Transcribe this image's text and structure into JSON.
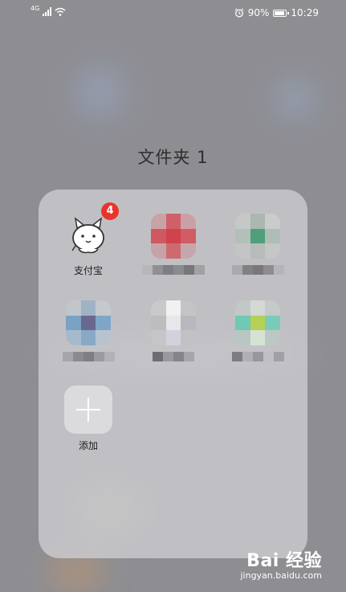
{
  "status_bar": {
    "network_type": "4G",
    "battery_percent": "90%",
    "time": "10:29",
    "icons": [
      "signal-icon",
      "wifi-icon",
      "alarm-icon",
      "battery-icon"
    ]
  },
  "folder": {
    "title": "文件夹 1",
    "apps": [
      {
        "label": "支付宝",
        "badge": "4",
        "icon": "alipay-icon"
      },
      {
        "label": "",
        "icon": "pixelated-red-icon"
      },
      {
        "label": "",
        "icon": "pixelated-green-icon"
      },
      {
        "label": "",
        "icon": "pixelated-blue-icon"
      },
      {
        "label": "",
        "icon": "pixelated-white-icon"
      },
      {
        "label": "",
        "icon": "pixelated-teal-icon"
      }
    ],
    "add_label": "添加"
  },
  "watermark": {
    "brand": "Bai 经验",
    "url": "jingyan.baidu.com"
  },
  "colors": {
    "badge": "#e8352b",
    "panel": "#cecdd2"
  }
}
